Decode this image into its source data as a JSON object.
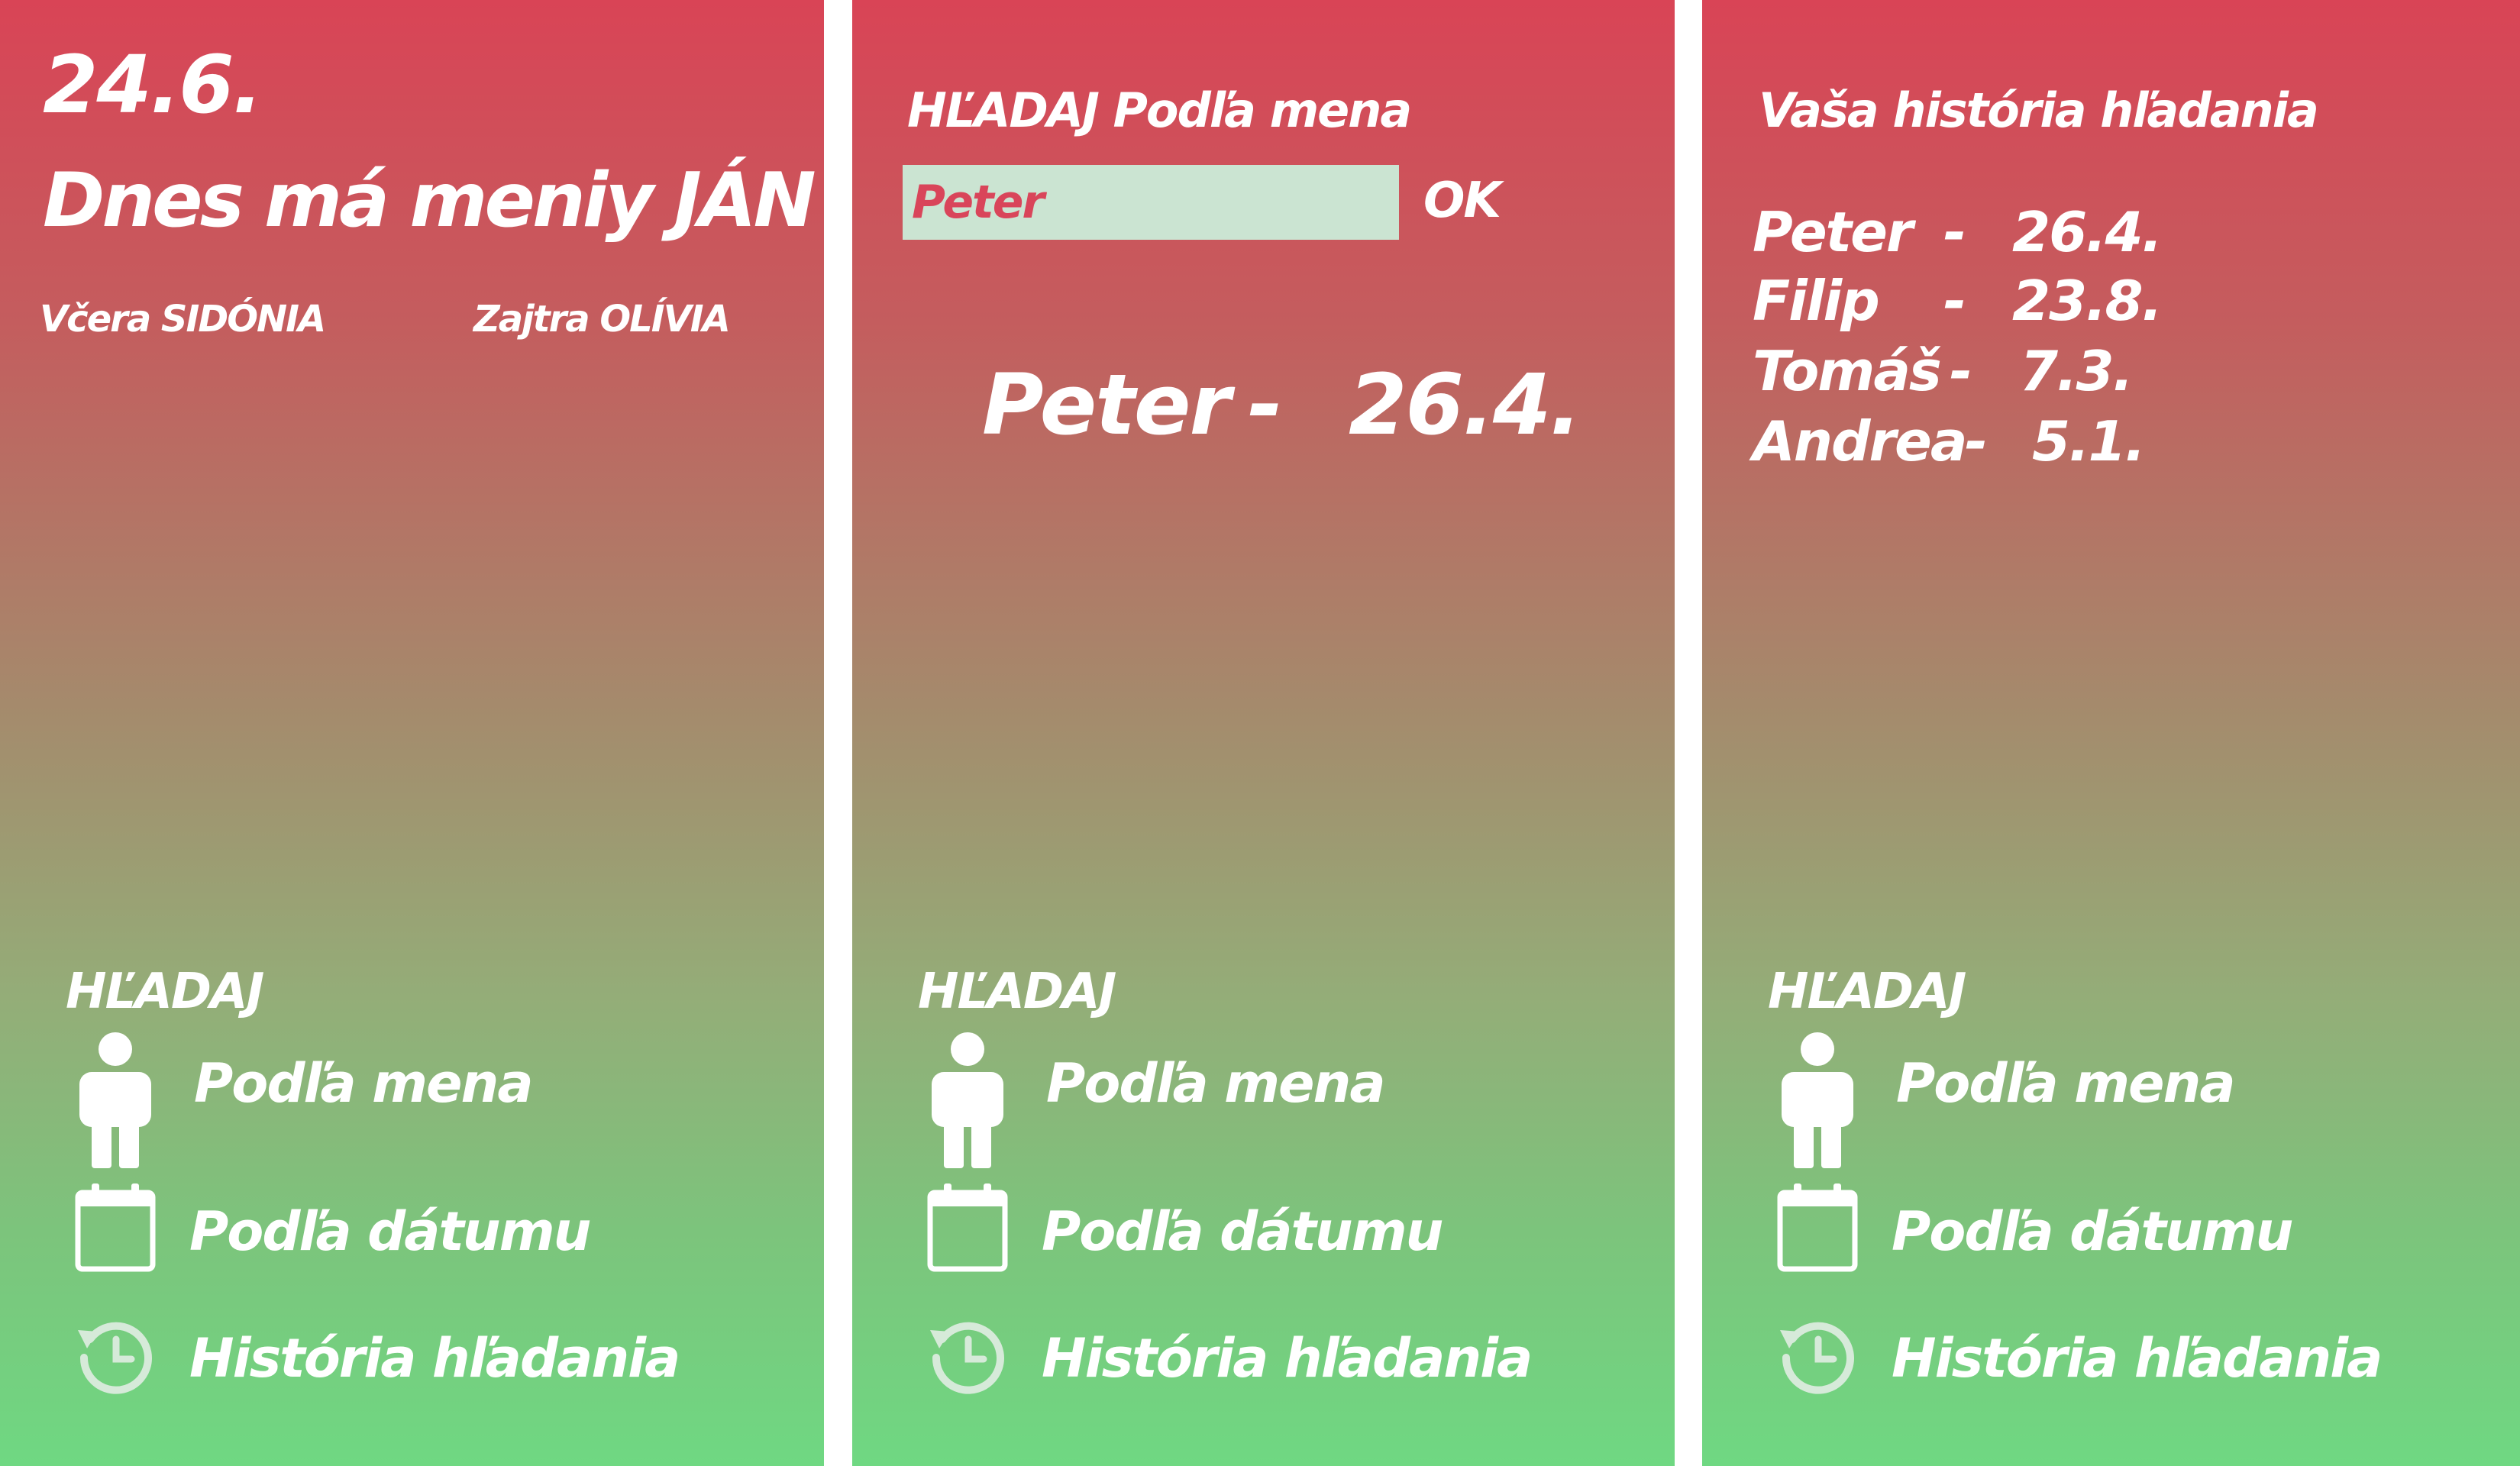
{
  "panel_today": {
    "date": "24.6.",
    "nameday": "Dnes má meniy JÁN",
    "yesterday": "Včera SIDÓNIA",
    "tomorrow": "Zajtra OLÍVIA"
  },
  "panel_search": {
    "title": "HĽADAJ  Podľa mena",
    "input_value": "Peter",
    "ok_label": "OK",
    "result": {
      "name": "Peter",
      "dash": "-",
      "date": "26.4."
    }
  },
  "panel_history": {
    "title": "Vaša história hľadania",
    "entries": [
      {
        "name": "Peter",
        "dash": "-",
        "date": "26.4."
      },
      {
        "name": "Filip",
        "dash": "-",
        "date": "23.8."
      },
      {
        "name": "Tomáš",
        "dash": "-",
        "date": "7.3."
      },
      {
        "name": "Andrea",
        "dash": "-",
        "date": "5.1."
      }
    ]
  },
  "nav": {
    "heading": "HĽADAJ",
    "by_name": "Podľa mena",
    "by_date": "Podľa  dátumu",
    "history": "História hľadania",
    "icons": [
      "person-icon",
      "calendar-icon",
      "history-icon"
    ]
  },
  "colors": {
    "gradient_top": "#d94456",
    "gradient_bottom": "#6fd882",
    "input_bg": "#cbe4d2",
    "input_text": "#d9455a",
    "text": "#ffffff"
  }
}
